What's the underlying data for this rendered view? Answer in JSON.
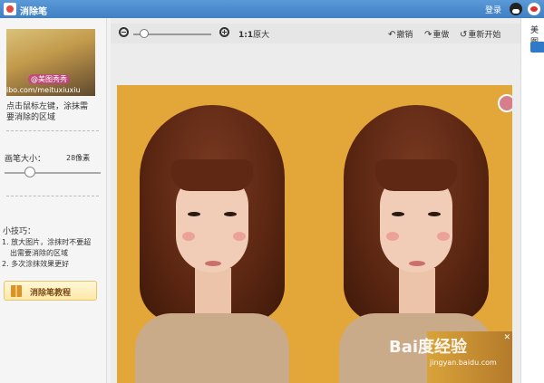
{
  "window": {
    "title": "消除笔",
    "login": "登录",
    "icons": [
      "app-icon",
      "qq-icon",
      "weibo-icon"
    ]
  },
  "sidebar": {
    "thumbnail_watermark": "ibo.com/meituxiuxiu",
    "thumbnail_badge": "@美图秀秀",
    "hint_line1": "点击鼠标左键，涂抹需",
    "hint_line2": "要消除的区域",
    "brush_size_label": "画笔大小：",
    "brush_size_value": "28像素",
    "brush_size_level": 0.28,
    "tips_title": "小技巧：",
    "tip1_line1": "1. 放大图片，涂抹时不要超",
    "tip1_line2": "出需要消除的区域",
    "tip2": "2. 多次涂抹效果更好",
    "tutorial_button": "消除笔教程"
  },
  "toolbar": {
    "ratio": "1:1",
    "ratio_label": "原大",
    "undo": "撤销",
    "redo": "重做",
    "restart": "重新开始",
    "zoom_level": 0.12
  },
  "canvas": {
    "watermark": "Bai度经验",
    "watermark_sub": "jingyan.baidu.com"
  },
  "right_panel": {
    "label": "美图"
  },
  "colors": {
    "titlebar": "#4a8ccf",
    "canvas_bg": "#e3a638",
    "accent_blue": "#2e79c8",
    "tutorial_button_bg": "#fde8a8"
  }
}
